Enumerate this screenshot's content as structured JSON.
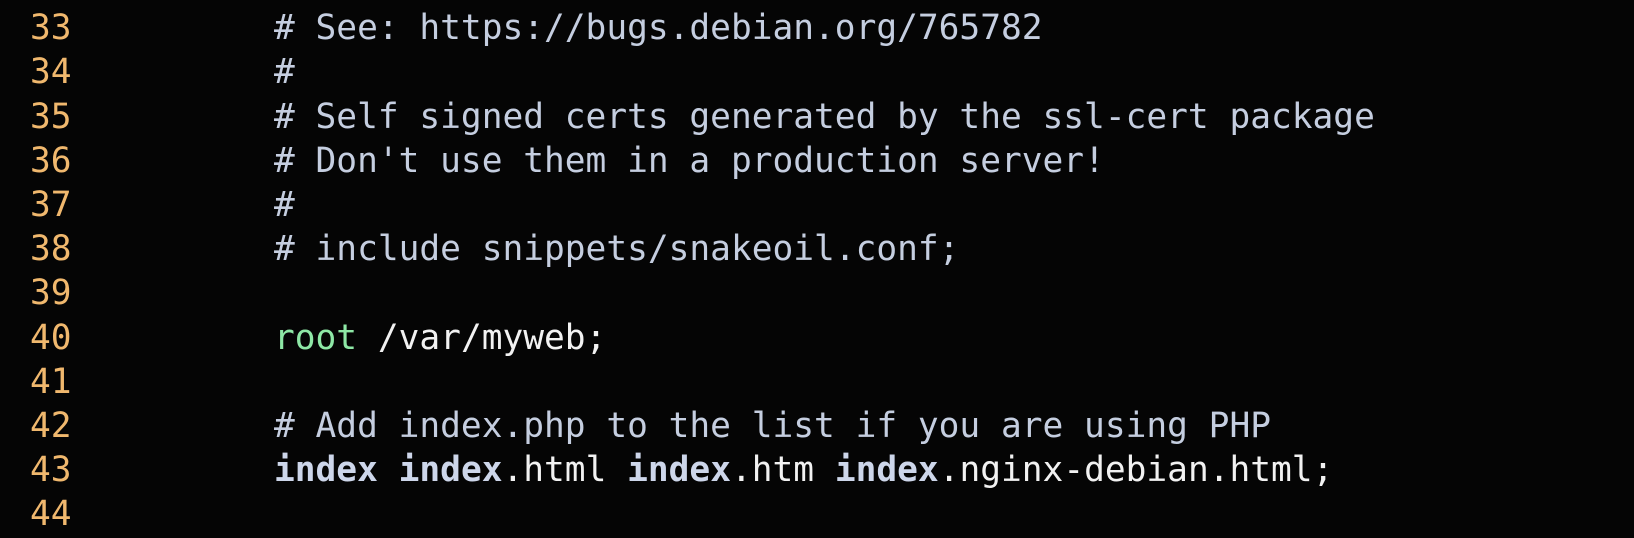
{
  "colors": {
    "background": "#050505",
    "line_number": "#f0b86e",
    "comment": "#c5cee0",
    "directive_root": "#8ee8a6",
    "plain_text": "#f2f2f2",
    "directive_index": "#cdd6ea"
  },
  "lines": [
    {
      "num": "33",
      "text": "# See: https://bugs.debian.org/765782"
    },
    {
      "num": "34",
      "text": "#"
    },
    {
      "num": "35",
      "text": "# Self signed certs generated by the ssl-cert package"
    },
    {
      "num": "36",
      "text": "# Don't use them in a production server!"
    },
    {
      "num": "37",
      "text": "#"
    },
    {
      "num": "38",
      "text": "# include snippets/snakeoil.conf;"
    },
    {
      "num": "39",
      "text": ""
    },
    {
      "num": "40",
      "keyword": "root",
      "rest": " /var/myweb;"
    },
    {
      "num": "41",
      "text": ""
    },
    {
      "num": "42",
      "text": "# Add index.php to the list if you are using PHP"
    },
    {
      "num": "43",
      "tokens": [
        "index",
        " ",
        "index",
        ".html ",
        "index",
        ".htm ",
        "index",
        ".nginx-debian.html;"
      ]
    },
    {
      "num": "44",
      "text": ""
    }
  ]
}
